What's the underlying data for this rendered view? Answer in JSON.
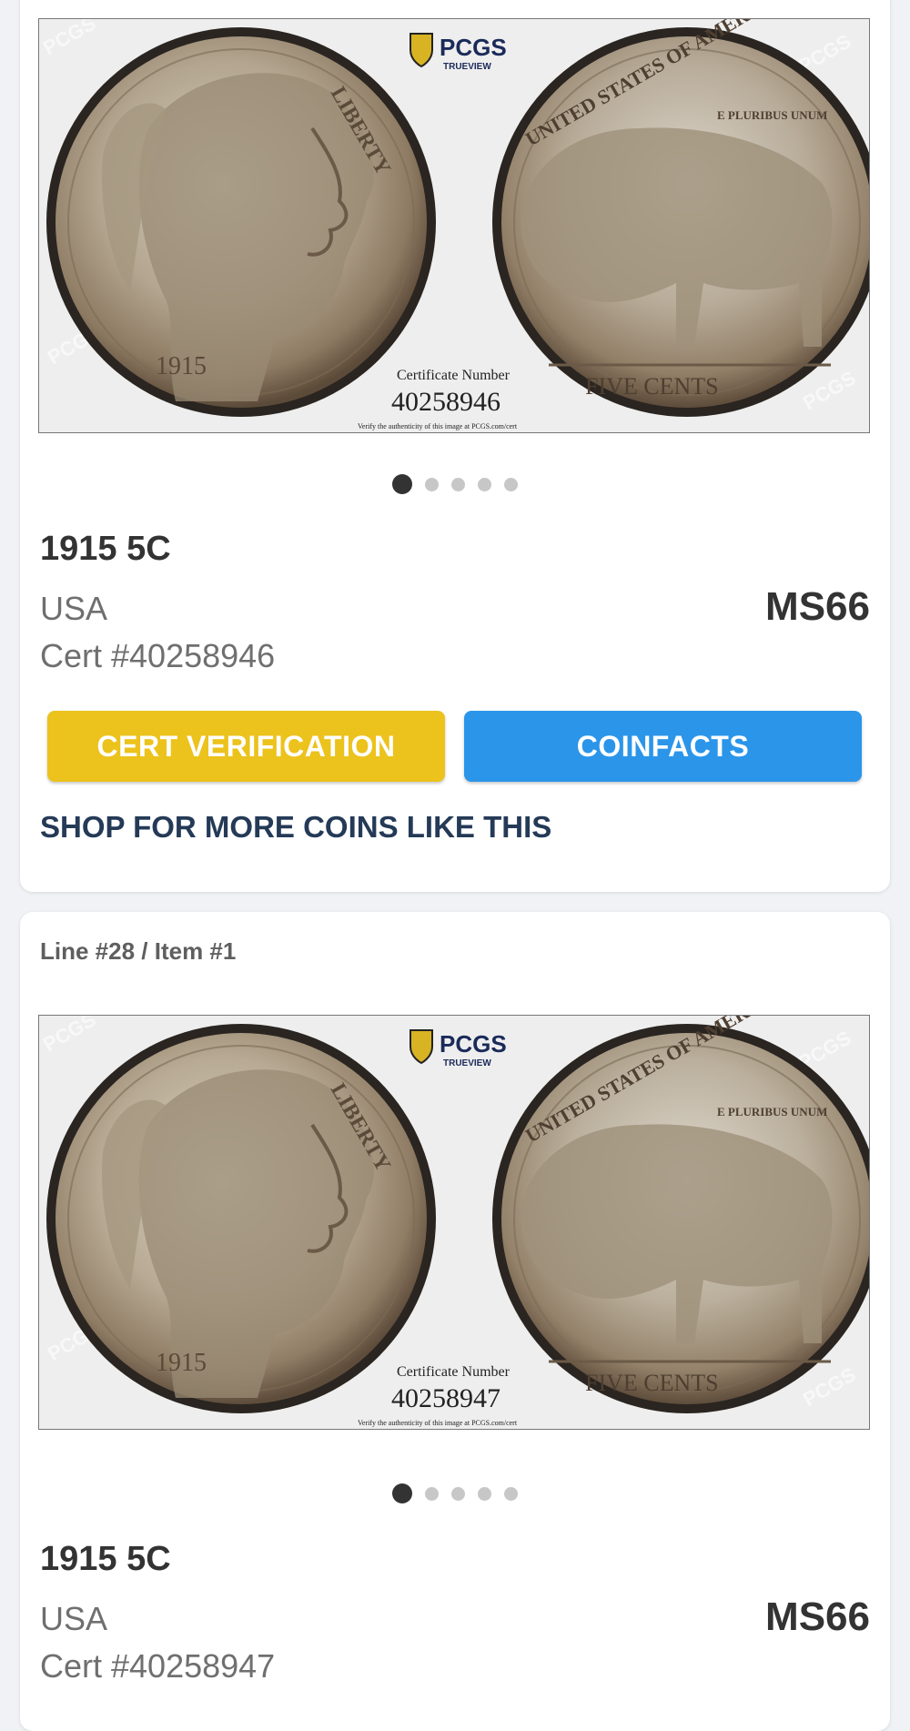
{
  "colors": {
    "page_background": "#f1f2f5",
    "card_background": "#ffffff",
    "cert_verification_button": "#ecc21c",
    "coinfacts_button": "#2b95ea",
    "shop_link": "#243a57",
    "active_dot": "#333333",
    "inactive_dot": "#c7c7c7"
  },
  "items": [
    {
      "line_label": "",
      "image": {
        "brand": "PCGS",
        "brand_sub": "TRUEVIEW",
        "obverse_legend": "LIBERTY",
        "obverse_date": "1915",
        "reverse_legend": "UNITED STATES OF AMERICA",
        "reverse_motto": "E PLURIBUS UNUM",
        "reverse_denomination": "FIVE CENTS",
        "certificate_label": "Certificate Number",
        "certificate_number": "40258946",
        "verify_note": "Verify the authenticity of this image at PCGS.com/cert"
      },
      "carousel": {
        "total": 5,
        "active": 1
      },
      "title": "1915 5C",
      "country": "USA",
      "cert": "Cert #40258946",
      "grade": "MS66",
      "cert_button": "CERT VERIFICATION",
      "coinfacts_button": "COINFACTS",
      "shop_link": "SHOP FOR MORE COINS LIKE THIS"
    },
    {
      "line_label": "Line #28 / Item #1",
      "image": {
        "brand": "PCGS",
        "brand_sub": "TRUEVIEW",
        "obverse_legend": "LIBERTY",
        "obverse_date": "1915",
        "reverse_legend": "UNITED STATES OF AMERICA",
        "reverse_motto": "E PLURIBUS UNUM",
        "reverse_denomination": "FIVE CENTS",
        "certificate_label": "Certificate Number",
        "certificate_number": "40258947",
        "verify_note": "Verify the authenticity of this image at PCGS.com/cert"
      },
      "carousel": {
        "total": 5,
        "active": 1
      },
      "title": "1915 5C",
      "country": "USA",
      "cert": "Cert #40258947",
      "grade": "MS66"
    }
  ]
}
